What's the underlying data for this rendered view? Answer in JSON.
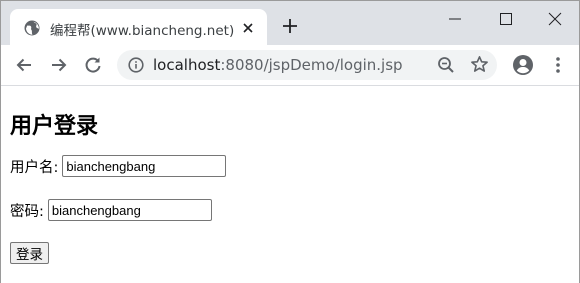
{
  "browser": {
    "tab": {
      "title": "编程帮(www.biancheng.net)",
      "favicon": "globe-icon"
    },
    "address": {
      "host": "localhost",
      "rest": ":8080/jspDemo/login.jsp"
    }
  },
  "page": {
    "title": "用户登录",
    "username": {
      "label": "用户名:",
      "value": "bianchengbang"
    },
    "password": {
      "label": "密码:",
      "value": "bianchengbang"
    },
    "submit_label": "登录"
  },
  "colors": {
    "tabstrip": "#dee1e6",
    "omnibox": "#f1f3f4",
    "icon": "#5f6368"
  }
}
